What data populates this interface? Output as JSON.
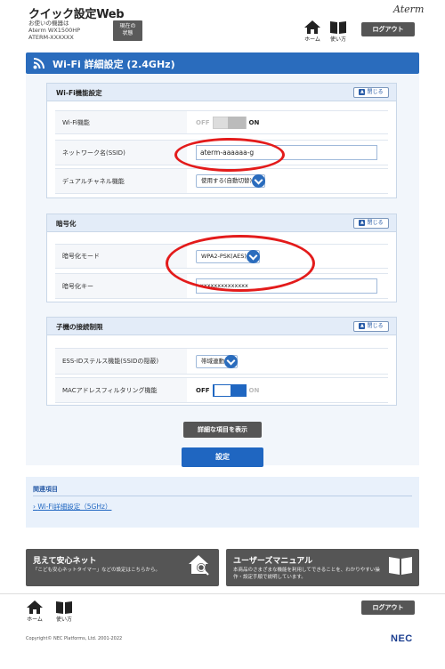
{
  "header": {
    "app_title": "クイック設定Web",
    "device_line1": "お使いの機器は",
    "device_line2": "Aterm WX1500HP",
    "device_line3": "ATERM-XXXXXX",
    "status_button_line1": "現在の",
    "status_button_line2": "状態",
    "brand": "Aterm",
    "home_label": "ホーム",
    "help_label": "使い方",
    "logout_label": "ログアウト"
  },
  "page": {
    "title": "Wi-Fi 詳細設定 (2.4GHz)"
  },
  "close_label": "閉じる",
  "sections": {
    "wifi_function": {
      "title": "Wi-Fi機能設定",
      "wifi_label": "Wi-Fi機能",
      "wifi_off": "OFF",
      "wifi_on": "ON",
      "wifi_state": "on",
      "ssid_label": "ネットワーク名(SSID)",
      "ssid_value": "aterm-aaaaaa-g",
      "dual_label": "デュアルチャネル機能",
      "dual_value": "使用する(自動切替)"
    },
    "encryption": {
      "title": "暗号化",
      "mode_label": "暗号化モード",
      "mode_value": "WPA2-PSK(AES)",
      "key_label": "暗号化キー",
      "key_value": "xxxxxxxxxxxxxx"
    },
    "client_limit": {
      "title": "子機の接続制限",
      "stealth_label": "ESS-IDステルス機能(SSIDの隠蔽)",
      "stealth_value": "帯域連動",
      "mac_label": "MACアドレスフィルタリング機能",
      "mac_off": "OFF",
      "mac_on": "ON",
      "mac_state": "off"
    }
  },
  "buttons": {
    "show_details": "詳細な項目を表示",
    "apply": "設定"
  },
  "related": {
    "title": "関連項目",
    "link": "Wi-Fi詳細設定（5GHz）"
  },
  "promos": {
    "anshin_title": "見えて安心ネット",
    "anshin_desc": "「こども安心ネットタイマー」などの設定はこちらから。",
    "manual_title": "ユーザーズマニュアル",
    "manual_desc_line1": "本商品のさまざまな機能を利用してできることを、わかりやすい操",
    "manual_desc_line2": "作・設定手順で説明しています。"
  },
  "footer": {
    "home_label": "ホーム",
    "help_label": "使い方",
    "logout_label": "ログアウト",
    "copyright": "Copyright© NEC Platforms, Ltd. 2001-2022",
    "nec": "NEC"
  },
  "colors": {
    "accent_blue": "#2a6cbd",
    "highlight_red": "#e31b1b",
    "dark_button": "#555555"
  }
}
